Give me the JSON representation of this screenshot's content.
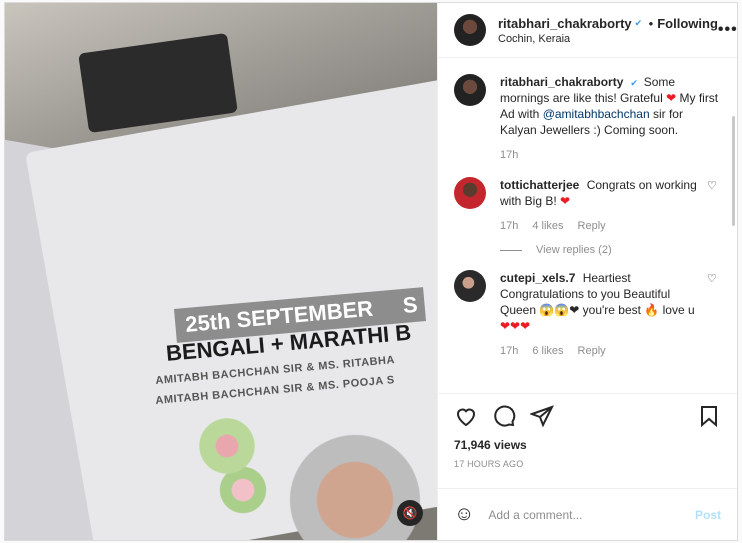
{
  "header": {
    "username": "ritabhari_chakraborty",
    "verified_icon": "verified-badge-icon",
    "separator": "•",
    "follow_label": "Following",
    "location": "Cochin, Keraia",
    "more_icon": "•••"
  },
  "caption": {
    "username": "ritabhari_chakraborty",
    "text_1": "Some mornings are like this! Grateful",
    "heart": "❤",
    "text_2": "My first Ad with",
    "mention": "@amitabhbachchan",
    "text_3": "sir for Kalyan Jewellers :) Coming soon.",
    "time": "17h"
  },
  "comments": [
    {
      "username": "tottichatterjee",
      "text": "Congrats on working with Big B!",
      "emoji": "❤",
      "time": "17h",
      "likes": "4 likes",
      "reply": "Reply",
      "view_replies": "View replies (2)"
    },
    {
      "username": "cutepi_xels.7",
      "text_1": "Heartiest Congratulations to you Beautiful Queen",
      "emojis_1": "😱😱❤",
      "text_2": "you're best",
      "emoji_fire": "🔥",
      "text_3": "love u",
      "emojis_2": "❤❤❤",
      "time": "17h",
      "likes": "6 likes",
      "reply": "Reply"
    }
  ],
  "actions": {
    "views": "71,946 views",
    "date": "17 HOURS AGO"
  },
  "add_comment": {
    "emoji_icon": "☺",
    "placeholder": "Add a comment...",
    "post_label": "Post"
  },
  "media": {
    "band_text": "25th SEPTEMBER",
    "band_extra": "S",
    "headline": "BENGALI + MARATHI B",
    "line_1": "AMITABH BACHCHAN SIR & MS. RITABHA",
    "line_2": "AMITABH BACHCHAN SIR & MS. POOJA S",
    "mute_icon": "🔇"
  }
}
